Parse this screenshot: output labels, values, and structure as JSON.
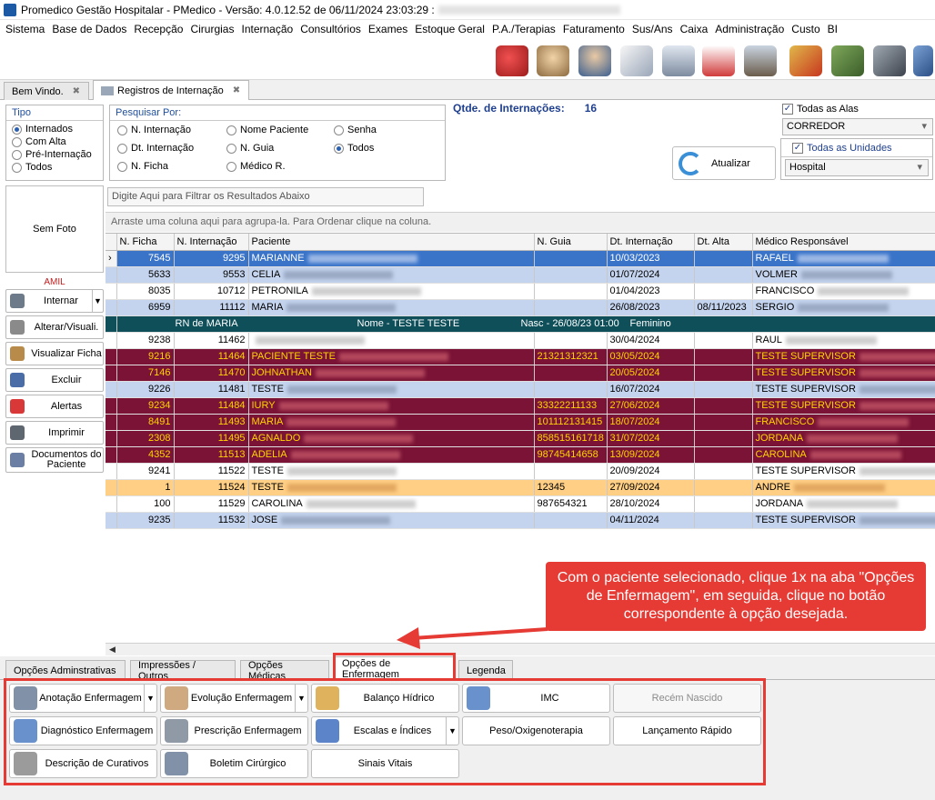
{
  "window": {
    "title": "Promedico Gestão Hospitalar - PMedico - Versão: 4.0.12.52 de 06/11/2024 23:03:29 :"
  },
  "menu": [
    "Sistema",
    "Base de Dados",
    "Recepção",
    "Cirurgias",
    "Internação",
    "Consultórios",
    "Exames",
    "Estoque Geral",
    "P.A./Terapias",
    "Faturamento",
    "Sus/Ans",
    "Caixa",
    "Administração",
    "Custo",
    "BI"
  ],
  "doc_tabs": [
    {
      "label": "Bem Vindo.",
      "active": false
    },
    {
      "label": "Registros de Internação",
      "active": true
    }
  ],
  "tipo": {
    "title": "Tipo",
    "options": [
      {
        "label": "Internados",
        "checked": true
      },
      {
        "label": "Com Alta",
        "checked": false
      },
      {
        "label": "Pré-Internação",
        "checked": false
      },
      {
        "label": "Todos",
        "checked": false
      }
    ]
  },
  "pesquisar": {
    "title": "Pesquisar Por:",
    "options": [
      {
        "label": "N. Internação",
        "checked": false
      },
      {
        "label": "Dt. Internação",
        "checked": false
      },
      {
        "label": "N. Ficha",
        "checked": false
      },
      {
        "label": "Nome Paciente",
        "checked": false
      },
      {
        "label": "N. Guia",
        "checked": false
      },
      {
        "label": "Médico R.",
        "checked": false
      },
      {
        "label": "Senha",
        "checked": false
      },
      {
        "label": "Todos",
        "checked": true
      }
    ]
  },
  "qtde": {
    "label": "Qtde. de Internações:",
    "value": "16"
  },
  "atualizar_label": "Atualizar",
  "alas": {
    "checkbox_label": "Todas as Alas",
    "checked": true,
    "value": "CORREDOR"
  },
  "unidades": {
    "checkbox_label": "Todas as Unidades",
    "checked": true,
    "value": "Hospital"
  },
  "sem_foto": "Sem Foto",
  "filter_placeholder": "Digite Aqui para Filtrar os Resultados Abaixo",
  "group_hint": "Arraste uma coluna aqui para agrupa-la. Para Ordenar clique na coluna.",
  "convenio": "AMIL",
  "side_buttons": [
    {
      "label": "Internar",
      "icon": "stethoscope-icon",
      "split": true
    },
    {
      "label": "Alterar/Visuali.",
      "icon": "pencil-icon",
      "split": false
    },
    {
      "label": "Visualizar Ficha",
      "icon": "id-card-icon",
      "split": false
    },
    {
      "label": "Excluir",
      "icon": "minus-icon",
      "split": false
    },
    {
      "label": "Alertas",
      "icon": "alert-icon",
      "split": false
    },
    {
      "label": "Imprimir",
      "icon": "printer-icon",
      "split": false
    },
    {
      "label": "Documentos do Paciente",
      "icon": "document-icon",
      "split": false
    }
  ],
  "grid": {
    "columns": [
      "N. Ficha",
      "N. Internação",
      "Paciente",
      "N. Guia",
      "Dt. Internação",
      "Dt. Alta",
      "Médico Responsável"
    ],
    "rows": [
      {
        "style": "sel",
        "cells": [
          "7545",
          "9295",
          "MARIANNE",
          "",
          "10/03/2023",
          "",
          "RAFAEL"
        ]
      },
      {
        "style": "blue",
        "cells": [
          "5633",
          "9553",
          "CELIA",
          "",
          "01/07/2024",
          "",
          "VOLMER"
        ]
      },
      {
        "style": "white",
        "cells": [
          "8035",
          "10712",
          "PETRONILA",
          "",
          "01/04/2023",
          "",
          "FRANCISCO"
        ]
      },
      {
        "style": "blue",
        "cells": [
          "6959",
          "11112",
          "MARIA",
          "",
          "26/08/2023",
          "08/11/2023",
          "SERGIO"
        ]
      },
      {
        "style": "teal",
        "cells": [
          "RN de MARIA",
          "Nome - TESTE TESTE",
          "Nasc - 26/08/23 01:00",
          "Feminino"
        ]
      },
      {
        "style": "white",
        "cells": [
          "9238",
          "11462",
          "",
          "",
          "30/04/2024",
          "",
          "RAUL"
        ]
      },
      {
        "style": "maroon",
        "cells": [
          "9216",
          "11464",
          "PACIENTE TESTE",
          "21321312321",
          "03/05/2024",
          "",
          "TESTE SUPERVISOR"
        ]
      },
      {
        "style": "maroon",
        "cells": [
          "7146",
          "11470",
          "JOHNATHAN",
          "",
          "20/05/2024",
          "",
          "TESTE SUPERVISOR"
        ]
      },
      {
        "style": "blue",
        "cells": [
          "9226",
          "11481",
          "TESTE",
          "",
          "16/07/2024",
          "",
          "TESTE SUPERVISOR"
        ]
      },
      {
        "style": "maroon",
        "cells": [
          "9234",
          "11484",
          "IURY",
          "33322211133",
          "27/06/2024",
          "",
          "TESTE SUPERVISOR"
        ]
      },
      {
        "style": "maroon",
        "cells": [
          "8491",
          "11493",
          "MARIA",
          "101112131415",
          "18/07/2024",
          "",
          "FRANCISCO"
        ]
      },
      {
        "style": "maroon",
        "cells": [
          "2308",
          "11495",
          "AGNALDO",
          "858515161718",
          "31/07/2024",
          "",
          "JORDANA"
        ]
      },
      {
        "style": "maroon",
        "cells": [
          "4352",
          "11513",
          "ADELIA",
          "98745414658",
          "13/09/2024",
          "",
          "CAROLINA"
        ]
      },
      {
        "style": "white",
        "cells": [
          "9241",
          "11522",
          "TESTE",
          "",
          "20/09/2024",
          "",
          "TESTE SUPERVISOR"
        ]
      },
      {
        "style": "orange",
        "cells": [
          "1",
          "11524",
          "TESTE",
          "12345",
          "27/09/2024",
          "",
          "ANDRE"
        ]
      },
      {
        "style": "white",
        "cells": [
          "100",
          "11529",
          "CAROLINA",
          "987654321",
          "28/10/2024",
          "",
          "JORDANA"
        ]
      },
      {
        "style": "blue",
        "cells": [
          "9235",
          "11532",
          "JOSE",
          "",
          "04/11/2024",
          "",
          "TESTE SUPERVISOR"
        ]
      }
    ]
  },
  "callout": "Com o paciente selecionado, clique 1x na aba \"Opções de Enfermagem\", em seguida, clique no botão correspondente à opção desejada.",
  "bottom_tabs": [
    "Opções Adminstrativas",
    "Impressões / Outros",
    "Opções Médicas",
    "Opções de Enfermagem",
    "Legenda"
  ],
  "active_bottom_tab": "Opções de Enfermagem",
  "option_buttons": [
    {
      "label": "Anotação Enfermagem",
      "icon": "notepad-icon",
      "split": true
    },
    {
      "label": "Evolução Enfermagem",
      "icon": "nurse-icon",
      "split": true
    },
    {
      "label": "Balanço Hídrico",
      "icon": "fluid-balance-icon",
      "split": false
    },
    {
      "label": "IMC",
      "icon": "chart-notepad-icon",
      "split": false
    },
    {
      "label": "Recém Nascido",
      "icon": "",
      "split": false,
      "disabled": true
    },
    {
      "label": "Diagnóstico Enfermagem",
      "icon": "diagnosis-icon",
      "split": false
    },
    {
      "label": "Prescrição Enfermagem",
      "icon": "prescription-icon",
      "split": false
    },
    {
      "label": "Escalas e Índices",
      "icon": "scales-icon",
      "split": true
    },
    {
      "label": "Peso/Oxigenoterapia",
      "icon": "",
      "split": false
    },
    {
      "label": "Lançamento Rápido",
      "icon": "",
      "split": false
    },
    {
      "label": "Descrição de Curativos",
      "icon": "bandage-icon",
      "split": false
    },
    {
      "label": "Boletim Cirúrgico",
      "icon": "clipboard-icon",
      "split": false
    },
    {
      "label": "Sinais Vitais",
      "icon": "",
      "split": false
    }
  ],
  "colors": {
    "selected": "#3a74c9",
    "alert_row": "#7a1336",
    "alert_text": "#ffd400",
    "highlight": "#ffcf85",
    "annotation": "#e63a34"
  }
}
